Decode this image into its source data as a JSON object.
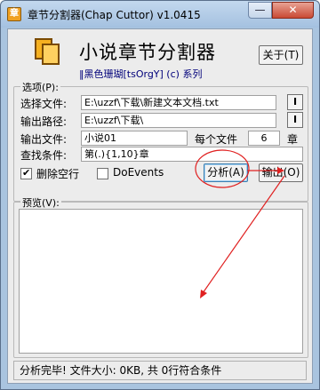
{
  "window": {
    "title": "章节分割器(Chap Cuttor) v1.0415",
    "minimize_glyph": "—",
    "close_glyph": "✕"
  },
  "header": {
    "title": "小说章节分割器",
    "subtitle": "‖黑色珊瑚[tsOrgY] (c) 系列",
    "about_button": "关于(T)"
  },
  "options": {
    "group_label": "选项(P):",
    "select_file_label": "选择文件:",
    "select_file_value": "E:\\uzzf\\下载\\新建文本文档.txt",
    "output_path_label": "输出路径:",
    "output_path_value": "E:\\uzzf\\下载\\",
    "output_file_label": "输出文件:",
    "output_file_value": "小说01",
    "per_file_label": "每个文件",
    "per_file_value": "6",
    "chapter_unit": "章",
    "search_label": "查找条件:",
    "search_value": "第(.){1,10}章",
    "browse_glyph": "I",
    "delete_blank_label": "删除空行",
    "doevents_label": "DoEvents",
    "analyze_button": "分析(A)",
    "output_button": "输出(O)"
  },
  "preview": {
    "group_label": "预览(V):"
  },
  "status": {
    "text": "分析完毕! 文件大小: 0KB, 共 0行符合条件"
  },
  "colors": {
    "annotation": "#e02020",
    "titlebar": "#a9c4df"
  },
  "checkboxes": {
    "delete_blank_checked": true,
    "doevents_checked": false
  }
}
